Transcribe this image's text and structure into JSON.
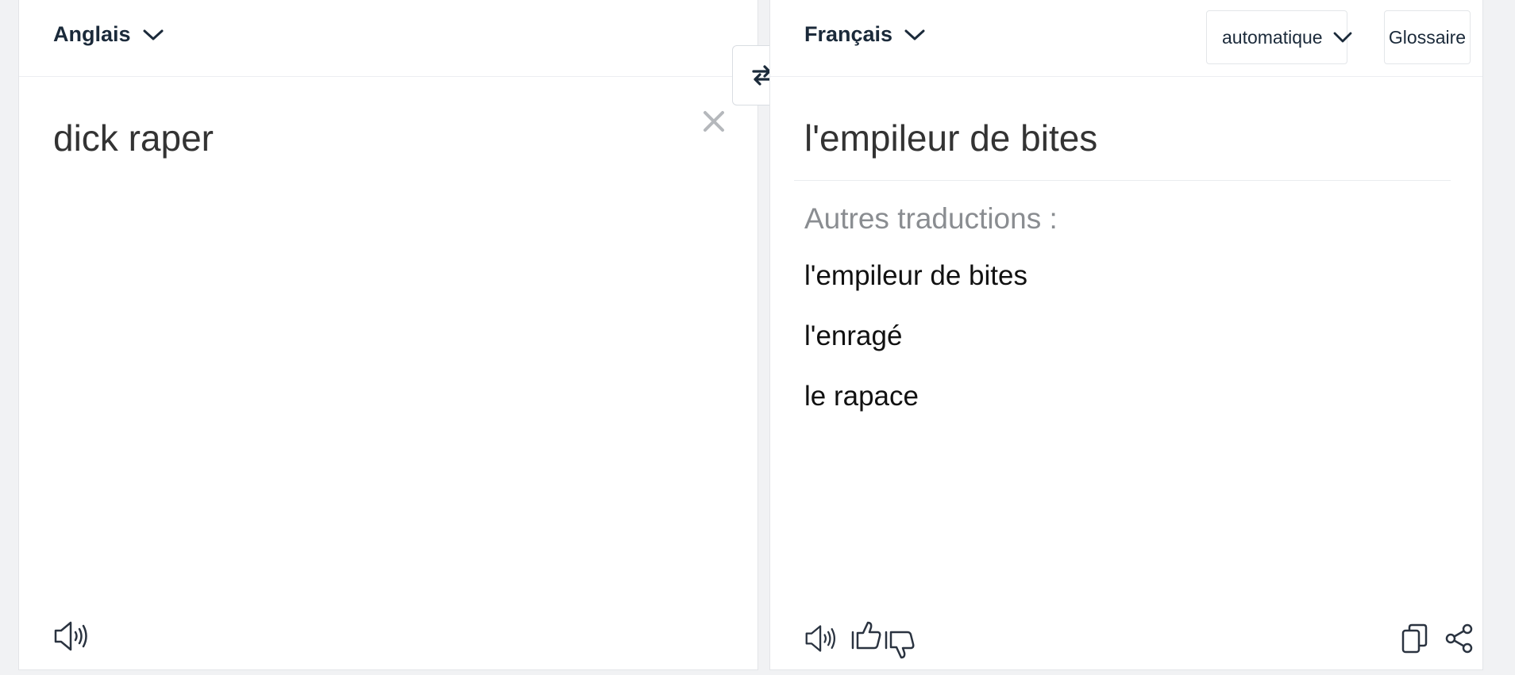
{
  "source": {
    "language": "Anglais",
    "text": "dick raper"
  },
  "target": {
    "language": "Français",
    "formality": "automatique",
    "glossary": "Glossaire",
    "translation": "l'empileur de bites",
    "alternatives_title": "Autres traductions :",
    "alternatives": [
      "l'empileur de bites",
      "l'enragé",
      "le rapace"
    ]
  },
  "colors": {
    "background": "#f1f2f4",
    "panel": "#ffffff",
    "text_dark": "#1b2a3a",
    "muted": "#8a8d91"
  },
  "icons": {
    "swap": "swap-arrows-icon",
    "clear": "close-icon",
    "speaker": "speaker-icon",
    "like": "thumbs-up-icon",
    "dislike": "thumbs-down-icon",
    "copy": "copy-icon",
    "share": "share-icon"
  }
}
